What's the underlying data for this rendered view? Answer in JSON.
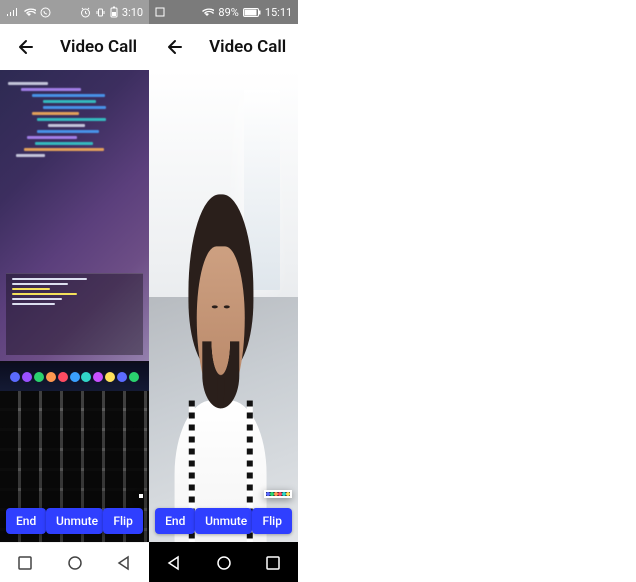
{
  "devices": [
    {
      "status": {
        "time": "3:10",
        "battery": ""
      },
      "title": "Video Call",
      "controls": {
        "end": "End",
        "mute": "Unmute",
        "flip": "Flip"
      }
    },
    {
      "status": {
        "time": "15:11",
        "battery": "89%"
      },
      "title": "Video Call",
      "controls": {
        "end": "End",
        "mute": "Unmute",
        "flip": "Flip"
      }
    }
  ],
  "icons": {
    "signal": "signal-icon",
    "wifi": "wifi-icon",
    "alarm": "alarm-icon",
    "vibrate": "vibrate-icon",
    "battery": "battery-icon",
    "whatsapp": "whatsapp-icon",
    "back": "back-icon"
  }
}
